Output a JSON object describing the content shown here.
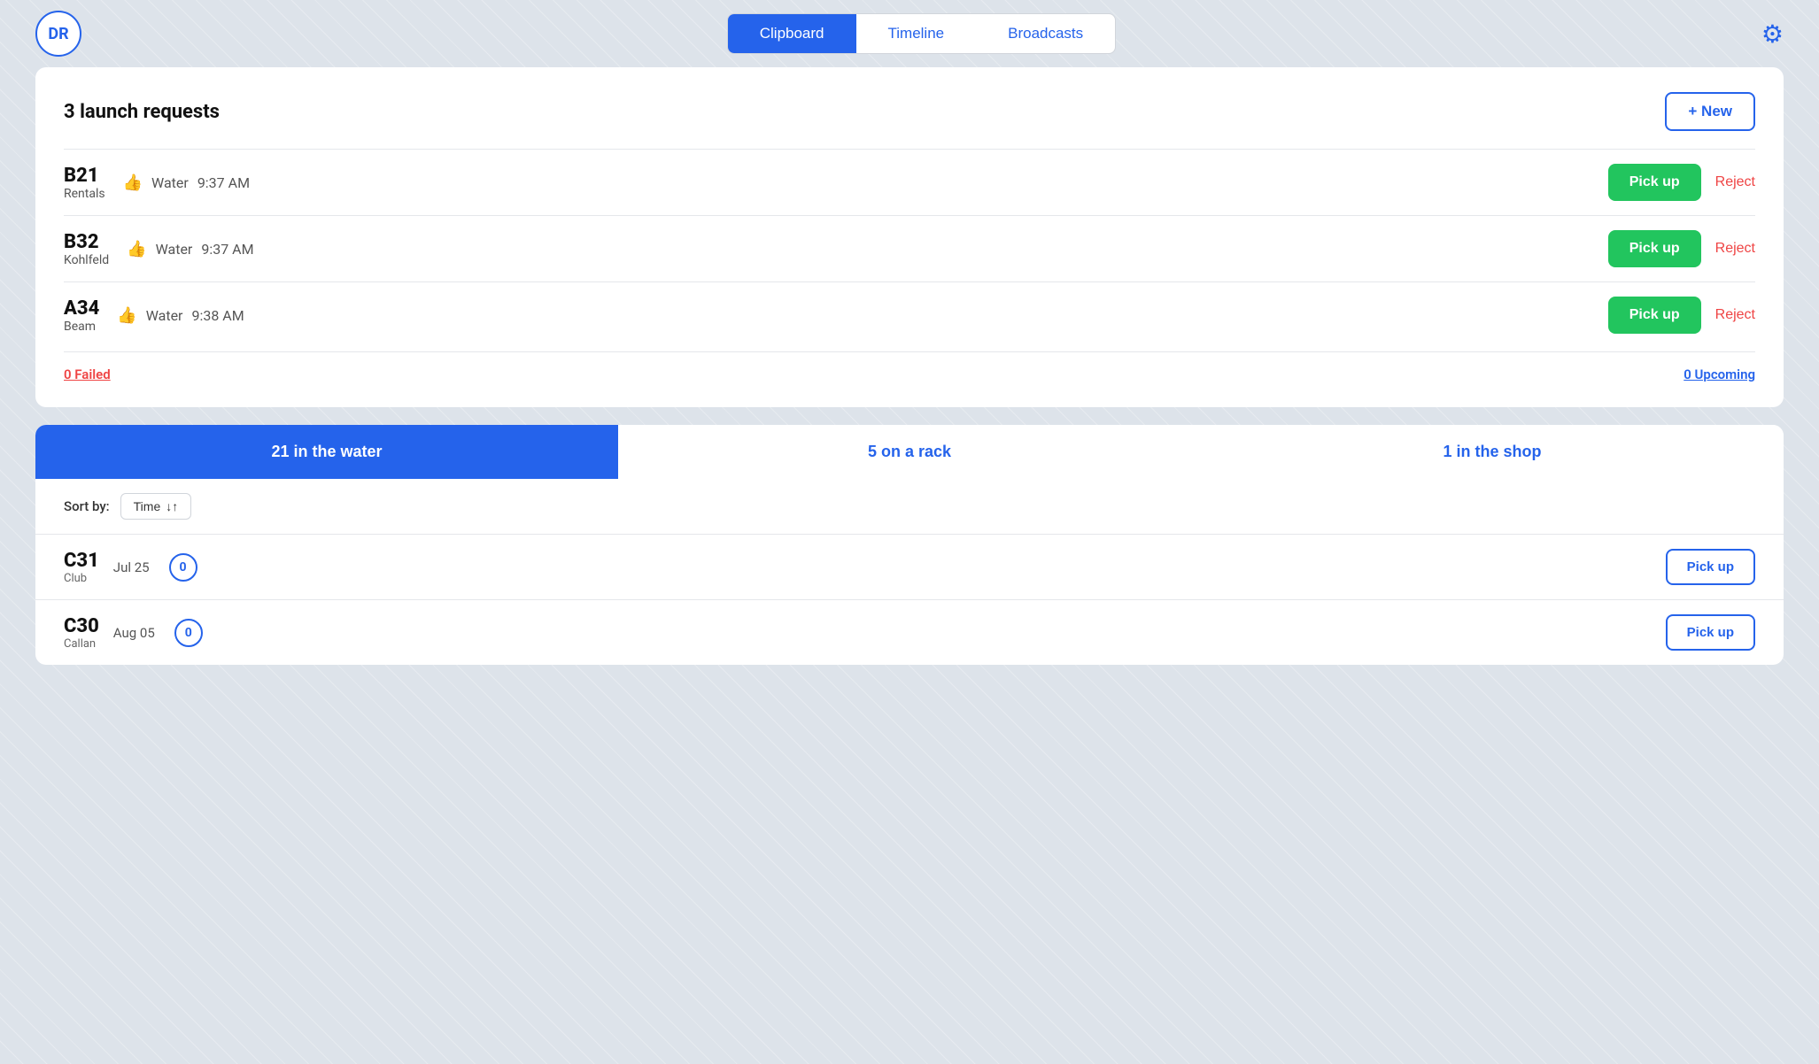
{
  "header": {
    "logo_text": "DR",
    "nav_tabs": [
      {
        "id": "clipboard",
        "label": "Clipboard",
        "active": true
      },
      {
        "id": "timeline",
        "label": "Timeline",
        "active": false
      },
      {
        "id": "broadcasts",
        "label": "Broadcasts",
        "active": false
      }
    ],
    "gear_label": "Settings"
  },
  "launch_requests": {
    "title": "3 launch requests",
    "new_button_label": "+ New",
    "requests": [
      {
        "code": "B21",
        "owner": "Rentals",
        "destination": "Water",
        "time": "9:37 AM",
        "pickup_label": "Pick up",
        "reject_label": "Reject"
      },
      {
        "code": "B32",
        "owner": "Kohlfeld",
        "destination": "Water",
        "time": "9:37 AM",
        "pickup_label": "Pick up",
        "reject_label": "Reject"
      },
      {
        "code": "A34",
        "owner": "Beam",
        "destination": "Water",
        "time": "9:38 AM",
        "pickup_label": "Pick up",
        "reject_label": "Reject"
      }
    ],
    "failed_label": "0 Failed",
    "upcoming_label": "0 Upcoming"
  },
  "status_tabs": {
    "tabs": [
      {
        "id": "water",
        "number": "21",
        "label": " in the water",
        "active": true
      },
      {
        "id": "rack",
        "number": "5",
        "label": " on a rack",
        "active": false
      },
      {
        "id": "shop",
        "number": "1",
        "label": " in the shop",
        "active": false
      }
    ]
  },
  "sort": {
    "label": "Sort by:",
    "value": "Time",
    "icon": "↓↑"
  },
  "boats": [
    {
      "code": "C31",
      "owner": "Club",
      "date": "Jul 25",
      "chat_count": "0",
      "pickup_label": "Pick up"
    },
    {
      "code": "C30",
      "owner": "Callan",
      "date": "Aug 05",
      "chat_count": "0",
      "pickup_label": "Pick up"
    }
  ]
}
